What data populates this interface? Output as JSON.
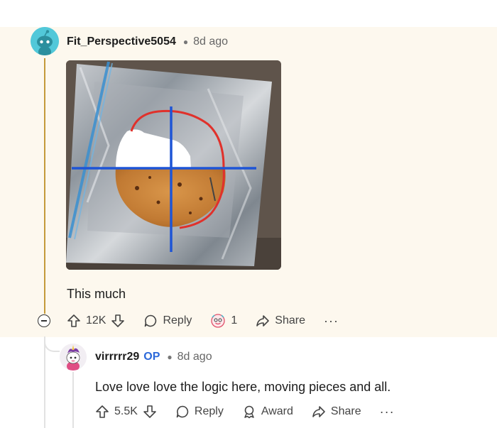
{
  "comment": {
    "username": "Fit_Perspective5054",
    "time": "8d ago",
    "text": "This much",
    "votes": "12K",
    "reply_label": "Reply",
    "award_count": "1",
    "share_label": "Share",
    "more_label": "···",
    "image_alt": "cookie-on-foil-photo",
    "thread_color": "#c49a3a",
    "background": "#fdf8ee"
  },
  "reply": {
    "username": "virrrrr29",
    "op_badge": "OP",
    "time": "8d ago",
    "text": "Love love love the logic here, moving pieces and all.",
    "votes": "5.5K",
    "reply_label": "Reply",
    "award_label": "Award",
    "share_label": "Share",
    "more_label": "···",
    "op_color": "#2b68d9"
  }
}
